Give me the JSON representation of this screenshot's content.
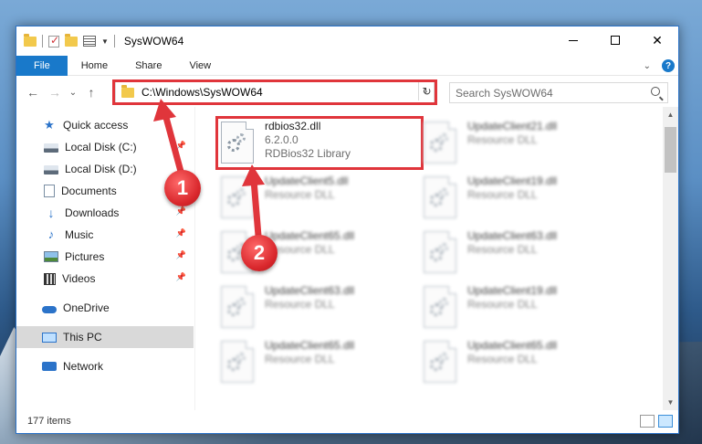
{
  "window": {
    "title": "SysWOW64",
    "controls": {
      "minimize": "",
      "maximize": "",
      "close": "✕"
    }
  },
  "ribbon": {
    "tabs": [
      "File",
      "Home",
      "Share",
      "View"
    ],
    "help_label": "?"
  },
  "nav": {
    "address": "C:\\Windows\\SysWOW64",
    "search_placeholder": "Search SysWOW64",
    "refresh_glyph": "↻",
    "back_glyph": "←",
    "forward_glyph": "→",
    "recent_glyph": "⌄",
    "up_glyph": "↑"
  },
  "sidebar": {
    "items": [
      {
        "label": "Quick access",
        "icon": "star-icon",
        "pinned": false
      },
      {
        "label": "Local Disk (C:)",
        "icon": "drive-icon",
        "pinned": true
      },
      {
        "label": "Local Disk (D:)",
        "icon": "drive-icon",
        "pinned": false
      },
      {
        "label": "Documents",
        "icon": "documents-icon",
        "pinned": true
      },
      {
        "label": "Downloads",
        "icon": "downloads-icon",
        "pinned": true
      },
      {
        "label": "Music",
        "icon": "music-icon",
        "pinned": true
      },
      {
        "label": "Pictures",
        "icon": "pictures-icon",
        "pinned": true
      },
      {
        "label": "Videos",
        "icon": "videos-icon",
        "pinned": true
      },
      {
        "label": "OneDrive",
        "icon": "onedrive-icon",
        "pinned": false
      },
      {
        "label": "This PC",
        "icon": "this-pc-icon",
        "pinned": false,
        "selected": true
      },
      {
        "label": "Network",
        "icon": "network-icon",
        "pinned": false
      }
    ]
  },
  "files": [
    {
      "name": "rdbios32.dll",
      "version": "6.2.0.0",
      "desc": "RDBios32 Library",
      "highlighted": true
    },
    {
      "name": "UpdateClient21.dll",
      "desc": "Resource DLL"
    },
    {
      "name": "UpdateClient5.dll",
      "desc": "Resource DLL"
    },
    {
      "name": "UpdateClient19.dll",
      "desc": "Resource DLL"
    },
    {
      "name": "UpdateClient65.dll",
      "desc": "Resource DLL"
    },
    {
      "name": "UpdateClient63.dll",
      "desc": "Resource DLL"
    },
    {
      "name": "UpdateClient63.dll",
      "desc": "Resource DLL"
    },
    {
      "name": "UpdateClient19.dll",
      "desc": "Resource DLL"
    },
    {
      "name": "UpdateClient65.dll",
      "desc": "Resource DLL"
    },
    {
      "name": "UpdateClient65.dll",
      "desc": "Resource DLL"
    }
  ],
  "status": {
    "item_count": "177 items"
  },
  "annotations": {
    "step1": "1",
    "step2": "2",
    "color": "#e0353b"
  },
  "colors": {
    "accent": "#1979ca",
    "highlight": "#e0353b"
  }
}
